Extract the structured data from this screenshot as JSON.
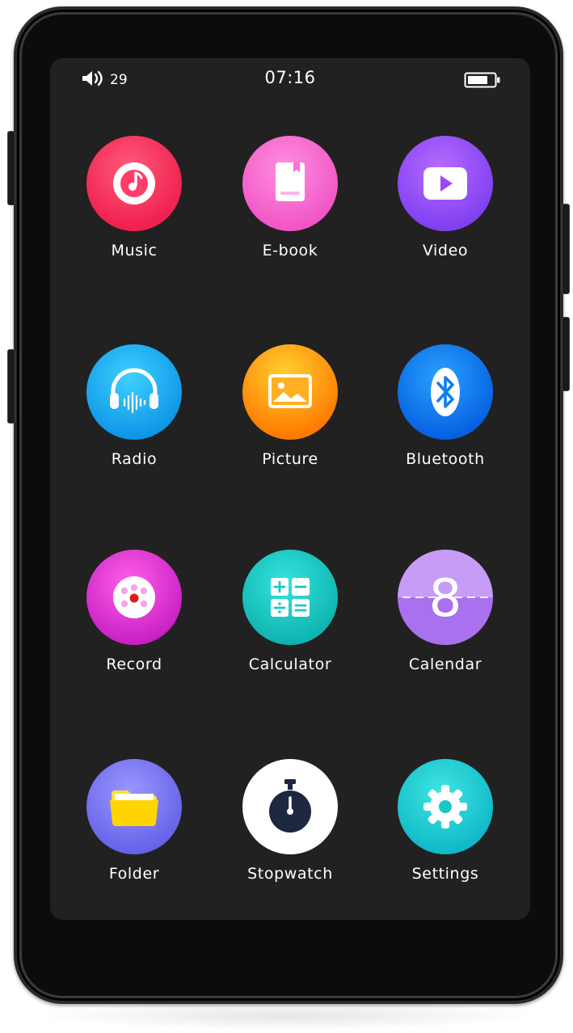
{
  "status_bar": {
    "volume_icon": "speaker-icon",
    "volume_level": "29",
    "time": "07:16",
    "battery_icon": "battery-icon"
  },
  "apps": [
    {
      "label": "Music",
      "icon": "music-note-icon",
      "color": "#ff3e6a"
    },
    {
      "label": "E-book",
      "icon": "book-icon",
      "color": "#ff6fcf"
    },
    {
      "label": "Video",
      "icon": "play-icon",
      "color": "#9b49f6"
    },
    {
      "label": "Radio",
      "icon": "headphones-icon",
      "color": "#1ab0f5"
    },
    {
      "label": "Picture",
      "icon": "image-icon",
      "color": "#ff8a00"
    },
    {
      "label": "Bluetooth",
      "icon": "bluetooth-icon",
      "color": "#0f7ff0"
    },
    {
      "label": "Record",
      "icon": "microphone-icon",
      "color": "#e33ad8"
    },
    {
      "label": "Calculator",
      "icon": "calculator-icon",
      "color": "#18c9c2"
    },
    {
      "label": "Calendar",
      "icon": "calendar-icon",
      "color": "#b784f2"
    },
    {
      "label": "Folder",
      "icon": "folder-icon",
      "color": "#7b79f2"
    },
    {
      "label": "Stopwatch",
      "icon": "stopwatch-icon",
      "color": "#ffffff"
    },
    {
      "label": "Settings",
      "icon": "gear-icon",
      "color": "#17c8c8"
    }
  ],
  "calendar_digit": "8"
}
